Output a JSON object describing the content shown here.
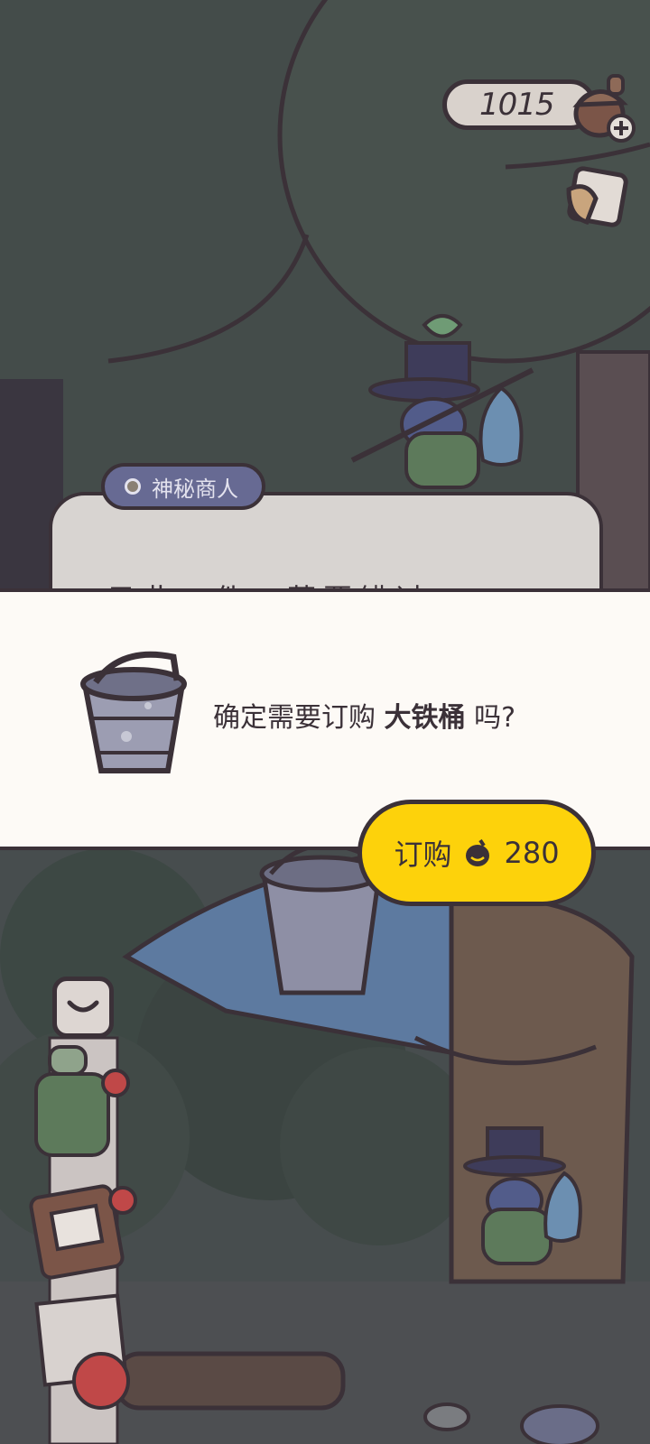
{
  "hud": {
    "acorn_count": "1015"
  },
  "npc": {
    "name": "神秘商人",
    "dialog_text": "只此一件，莫要错过"
  },
  "confirm": {
    "prompt_before": "确定需要订购 ",
    "item_name": "大铁桶",
    "prompt_after": " 吗?",
    "buy_label": "订购",
    "price": "280"
  },
  "icons": [
    "acorn-plus-icon",
    "letter-icon",
    "bucket-icon",
    "acorn-icon",
    "chevron-down-icon",
    "backpack-icon",
    "notebook-icon",
    "apple-icon"
  ]
}
